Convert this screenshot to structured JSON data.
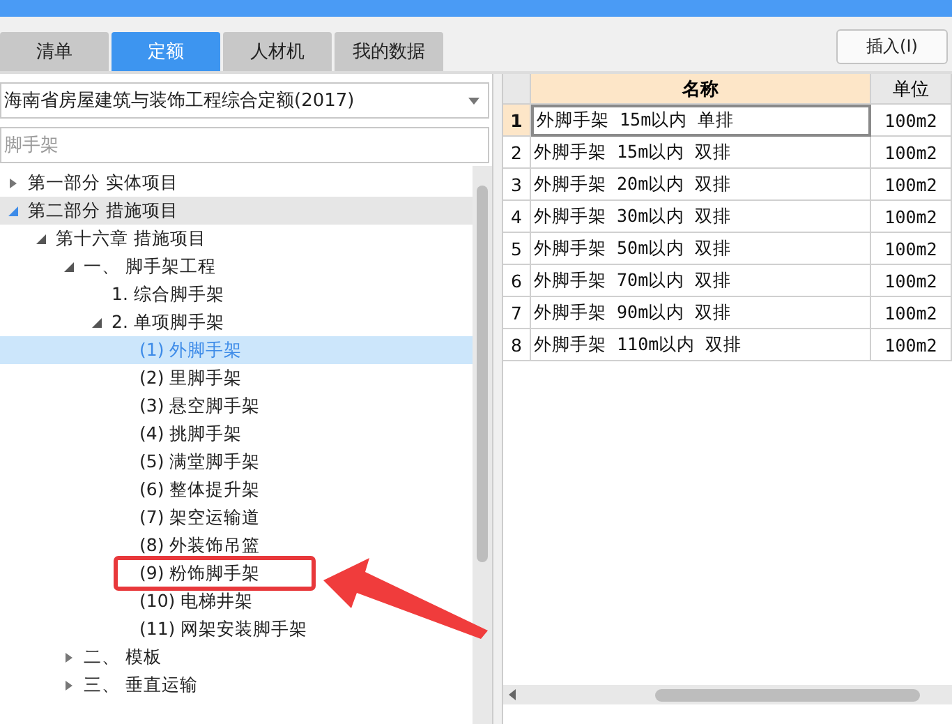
{
  "tabs": [
    {
      "label": "清单",
      "selected": false
    },
    {
      "label": "定额",
      "selected": true
    },
    {
      "label": "人材机",
      "selected": false
    },
    {
      "label": "我的数据",
      "selected": false
    }
  ],
  "insert_button": "插入(I)",
  "library_select": {
    "value": "海南省房屋建筑与装饰工程综合定额(2017)"
  },
  "search": {
    "value": "脚手架"
  },
  "tree": [
    {
      "label": "第一部分 实体项目",
      "expanded": false,
      "selected": false,
      "hovered": false
    },
    {
      "label": "第二部分 措施项目",
      "expanded": true,
      "selected": false,
      "hovered": true,
      "children": [
        {
          "label": "第十六章 措施项目",
          "expanded": true,
          "selected": false,
          "hovered": false,
          "children": [
            {
              "label": "一、  脚手架工程",
              "expanded": true,
              "selected": false,
              "hovered": false,
              "children": [
                {
                  "label": "1. 综合脚手架",
                  "selected": false,
                  "hovered": false
                },
                {
                  "label": "2. 单项脚手架",
                  "expanded": true,
                  "selected": false,
                  "hovered": false,
                  "children": [
                    {
                      "label": "(1) 外脚手架",
                      "selected": true,
                      "hovered": false
                    },
                    {
                      "label": "(2) 里脚手架",
                      "selected": false,
                      "hovered": false
                    },
                    {
                      "label": "(3) 悬空脚手架",
                      "selected": false,
                      "hovered": false
                    },
                    {
                      "label": "(4) 挑脚手架",
                      "selected": false,
                      "hovered": false
                    },
                    {
                      "label": "(5) 满堂脚手架",
                      "selected": false,
                      "hovered": false
                    },
                    {
                      "label": "(6) 整体提升架",
                      "selected": false,
                      "hovered": false
                    },
                    {
                      "label": "(7) 架空运输道",
                      "selected": false,
                      "hovered": false
                    },
                    {
                      "label": "(8) 外装饰吊篮",
                      "selected": false,
                      "hovered": false
                    },
                    {
                      "label": "(9) 粉饰脚手架",
                      "selected": false,
                      "hovered": false
                    },
                    {
                      "label": "(10) 电梯井架",
                      "selected": false,
                      "hovered": false
                    },
                    {
                      "label": "(11) 网架安装脚手架",
                      "selected": false,
                      "hovered": false
                    }
                  ]
                }
              ]
            },
            {
              "label": "二、  模板",
              "expanded": false,
              "selected": false,
              "hovered": false
            },
            {
              "label": "三、  垂直运输",
              "expanded": false,
              "selected": false,
              "hovered": false
            }
          ]
        }
      ]
    }
  ],
  "table": {
    "columns": [
      "名称",
      "单位"
    ],
    "rows": [
      {
        "index": "1",
        "name": "外脚手架 15m以内 单排",
        "unit": "100m2",
        "selected": true
      },
      {
        "index": "2",
        "name": "外脚手架 15m以内 双排",
        "unit": "100m2",
        "selected": false
      },
      {
        "index": "3",
        "name": "外脚手架 20m以内 双排",
        "unit": "100m2",
        "selected": false
      },
      {
        "index": "4",
        "name": "外脚手架 30m以内 双排",
        "unit": "100m2",
        "selected": false
      },
      {
        "index": "5",
        "name": "外脚手架 50m以内 双排",
        "unit": "100m2",
        "selected": false
      },
      {
        "index": "6",
        "name": "外脚手架 70m以内 双排",
        "unit": "100m2",
        "selected": false
      },
      {
        "index": "7",
        "name": "外脚手架 90m以内 双排",
        "unit": "100m2",
        "selected": false
      },
      {
        "index": "8",
        "name": "外脚手架 110m以内 双排",
        "unit": "100m2",
        "selected": false
      }
    ]
  }
}
